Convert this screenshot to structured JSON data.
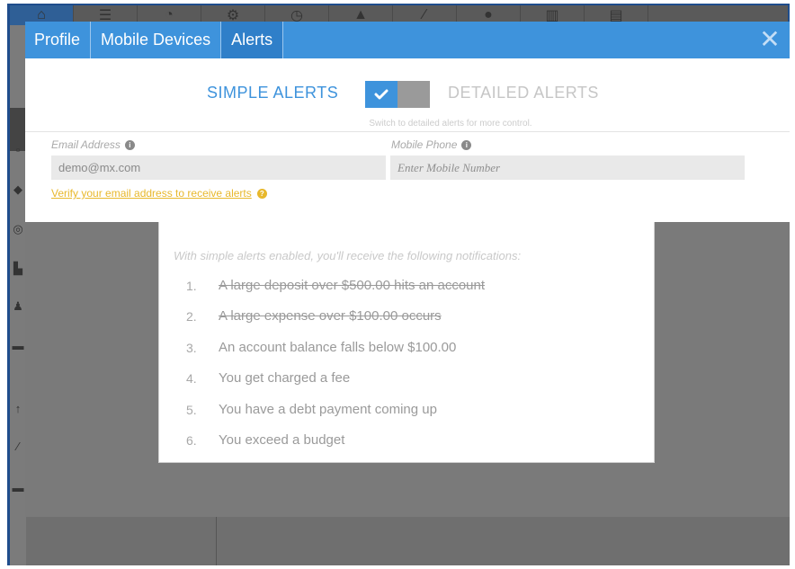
{
  "modal": {
    "tabs": [
      {
        "label": "Profile",
        "active": false
      },
      {
        "label": "Mobile Devices",
        "active": false
      },
      {
        "label": "Alerts",
        "active": true
      }
    ],
    "close_icon": "close-icon"
  },
  "alerts": {
    "simple_label": "SIMPLE ALERTS",
    "detailed_label": "DETAILED ALERTS",
    "toggle_state": "simple",
    "hint": "Switch to detailed alerts for more control.",
    "email": {
      "label": "Email Address",
      "value": "demo@mx.com"
    },
    "phone": {
      "label": "Mobile Phone",
      "placeholder": "Enter Mobile Number"
    },
    "verify_link": "Verify your email address to receive alerts",
    "intro": "With simple alerts enabled, you'll receive the following notifications:",
    "notifications": [
      {
        "num": "1.",
        "text": "A large deposit over $500.00 hits an account",
        "disabled": true
      },
      {
        "num": "2.",
        "text": "A large expense over $100.00 occurs",
        "disabled": true
      },
      {
        "num": "3.",
        "text": "An account balance falls below $100.00",
        "disabled": false
      },
      {
        "num": "4.",
        "text": "You get charged a fee",
        "disabled": false
      },
      {
        "num": "5.",
        "text": "You have a debt payment coming up",
        "disabled": false
      },
      {
        "num": "6.",
        "text": "You exceed a budget",
        "disabled": false
      }
    ]
  },
  "colors": {
    "accent": "#3e93dc",
    "link": "#e8b82c",
    "overlay": "#7a7a7a"
  }
}
